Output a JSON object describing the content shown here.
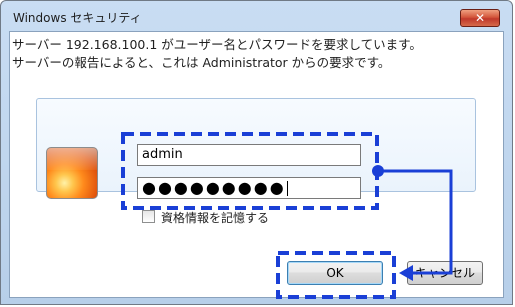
{
  "window": {
    "title": "Windows セキュリティ",
    "close_label": "✕"
  },
  "message": {
    "line1": "サーバー 192.168.100.1 がユーザー名とパスワードを要求しています。",
    "line2": "サーバーの報告によると、これは Administrator からの要求です。"
  },
  "credentials": {
    "username_value": "admin",
    "password_mask": "●●●●●●●●●",
    "remember_label": "資格情報を記憶する",
    "remember_checked": false
  },
  "buttons": {
    "ok_label": "OK",
    "cancel_label": "キャンセル"
  },
  "colors": {
    "annotation_blue": "#1a3fd6",
    "title_bar": "#c9ddf3",
    "close_red": "#c0392b"
  },
  "icons": {
    "avatar": "user-picture-flower-icon",
    "close": "close-icon"
  }
}
